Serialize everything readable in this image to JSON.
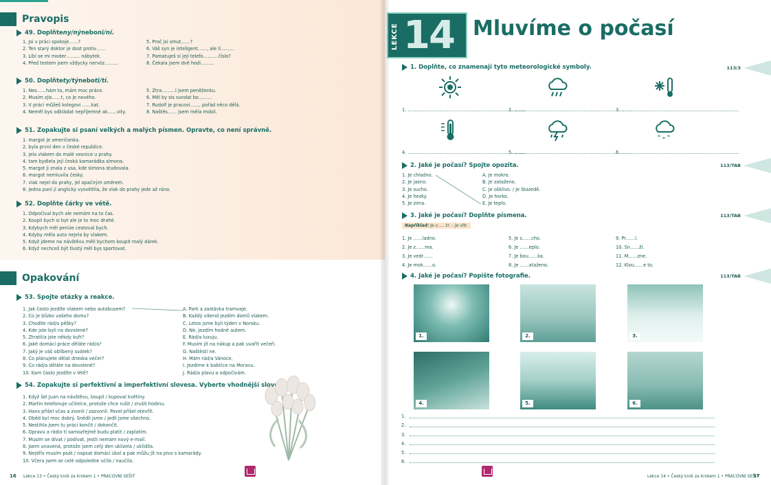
{
  "left": {
    "pravopis": {
      "title": "Pravopis",
      "t49": {
        "label_a": "49. Doplňte ",
        "label_b": "ny/ný",
        "label_c": " nebo ",
        "label_d": "ni/ní.",
        "col1": [
          "1. Jsi v práci spokoje……?",
          "2. Ten starý doktor je dost protiv……",
          "3. Líbí se mi moder……… nábytek.",
          "4. Před testem jsem vždycky nervóz………"
        ],
        "col2": [
          "5. Proč jsi smut……?",
          "6. Váš syn je inteligent……, ale lí………",
          "7. Pamatuješ si její telefo……… číslo?",
          "8. Čekala jsem dvě hodi………"
        ]
      },
      "t50": {
        "label_a": "50. Doplňte ",
        "label_b": "ty/tý",
        "label_c": " nebo ",
        "label_d": "ti/tí.",
        "col1": [
          "1. Nes……hám to, mám moc práce.",
          "2. Musím zjis……t, co je nového.",
          "3. V práci můžeš kolegovi ……kat.",
          "4. Neměl bys odkládat nepříjemné ak……vity."
        ],
        "col2": [
          "5. Ztra………l jsem peněženku.",
          "6. Měl by sis sundat bo………",
          "7. Rudolf je pracovi……, pořád něco dělá.",
          "8. Naštěs…… jsem měla mobil."
        ]
      },
      "t51": {
        "label": "51. Zopakujte si psaní velkých a malých písmen. Opravte, co není správně.",
        "items": [
          "1. margot je američanka.",
          "2. byla první den v české republice.",
          "3. jela vlakem do malé vesnice u prahy.",
          "4. tam bydlela její česká kamarádka simona.",
          "5. margot ji znala z usa, kde simona studovala.",
          "6. margot nemluvila česky.",
          "7. vlak nejel do prahy, jel opačným směrem.",
          "8. jedna paní jí anglicky vysvětlila, že vlak do prahy jede až ráno."
        ]
      },
      "t52": {
        "label": "52. Doplňte čárky ve větě.",
        "items": [
          "1. Odpočíval bych ale nemám na to čas.",
          "2. Koupil bych si byt ale je to moc drahé.",
          "3. Kdybych měl peníze cestoval bych.",
          "4. Kdyby měla auto nejela by vlakem.",
          "5. Když jdeme na návštěvu měli bychom koupit malý dárek.",
          "6. Když nechceš být tlustý měl bys sportovat."
        ]
      }
    },
    "opakovani": {
      "title": "Opakování",
      "t53": {
        "label": "53. Spojte otázky a reakce.",
        "questions": [
          "1. Jak často jezdíte vlakem nebo autobusem?",
          "2. Co je blízko vašeho domu?",
          "3. Chodíte rád/a pěšky?",
          "4. Kde jste byli na dovolené?",
          "5. Ztratil/a jste někdy kufr?",
          "6. Jaké domácí práce děláte rád/a?",
          "7. Jaký je váš oblíbený svátek?",
          "8. Co plánujete dělat dneska večer?",
          "9. Co rád/a děláte na dovolené?",
          "10. Kam často jezdíte v létě?"
        ],
        "answers": [
          "A. Park a zastávka tramvaje.",
          "B. Každý víkend jezdím domů vlakem.",
          "C. Letos jsme byli týden v Norsku.",
          "D. Ne, jezdím hodně autem.",
          "E. Rád/a luxuju.",
          "F. Musím jít na nákup a pak uvařit večeři.",
          "G. Naštěstí ne.",
          "H. Mám rád/a Vánoce.",
          "I. Jezdíme k babičce na Moravu.",
          "J. Rád/a plavu a odpočívám."
        ]
      },
      "t54": {
        "label": "54. Zopakujte si perfektivní a imperfektivní slovesa. Vyberte vhodnější sloveso.",
        "items": [
          "1. Když šel Juan na návštěvu, koupil / kupoval květiny.",
          "2. Martin telefonuje učitelce, protože chce rušit / zrušit hodinu.",
          "3. Hans přišel včas a zvonil / zazvonil. Pavel přišel otevřít.",
          "4. Oběd byl moc dobrý. Snědli jsme / jedli jsme všechno.",
          "5. Nestihla jsem tu práci končit / dokončit.",
          "6. Opravu a rádio ti samozřejmě budu platit / zaplatím.",
          "7. Musím se dívat / podívat, jestli nemám nový e-mail.",
          "8. Jsem unavená, protože jsem celý den uklízela / uklidila.",
          "9. Nejdřív musím psát / napsat domácí úkol a pak můžu jít na pivo s kamarády.",
          "10. Včera jsem se celé odpoledne učila / naučila."
        ]
      }
    },
    "footer": {
      "page": "16",
      "text": "Lekce 13 • Český krok za krokem 1 • PRACOVNÍ SEŠIT"
    }
  },
  "right": {
    "lekce_word": "LEKCE",
    "lekce_number": "14",
    "title": "Mluvíme o počasí",
    "t1": {
      "label": "1. Doplňte, co znamenají tyto meteorologické symboly.",
      "ref": "113/3",
      "lines_row1": [
        "1. ……………………………………………………………………",
        "2. ……………………………………………………………………",
        "3. ……………………………………………………………………"
      ],
      "lines_row2": [
        "4. ……………………………………………………………………",
        "5. ……………………………………………………………………",
        "6. ……………………………………………………………………"
      ],
      "icons": [
        "sun-icon",
        "rain-cloud-icon",
        "frost-thermometer-icon",
        "hot-thermometer-icon",
        "storm-cloud-icon",
        "snow-cloud-icon"
      ]
    },
    "t2": {
      "label": "2. Jaké je počasí? Spojte opozita.",
      "ref": "113/TAB",
      "col1": [
        "1. Je chladno.",
        "2. Je jasno.",
        "3. Je sucho.",
        "4. Je hezky.",
        "5. Je zima."
      ],
      "col2": [
        "A. Je mokro.",
        "B. Je zataženo.",
        "C. Je ošklivo. / Je škaredě.",
        "D. Je horko.",
        "E. Je teplo."
      ]
    },
    "t3": {
      "label": "3. Jaké je počasí? Doplňte písmena.",
      "ref": "113/TAB",
      "hint_label": "Například:",
      "hint_text": " Je v……tr. – Je vítr.",
      "col1": [
        "1. Je ……ladno.",
        "2. Je z……ma.",
        "3. Je vedr……",
        "4. Je mok……o."
      ],
      "col2": [
        "5. Je s……cho.",
        "6. Je ……eplo.",
        "7. Je bou……ka.",
        "8. Je ……ataženo."
      ],
      "col3": [
        "9. Pr……í.",
        "10. Sn……ží.",
        "11. M……zne.",
        "12. Klou……e to."
      ]
    },
    "t4": {
      "label": "4. Jaké je počasí? Popište fotografie.",
      "ref": "113/TAB",
      "photos": [
        "1.",
        "2.",
        "3.",
        "4.",
        "5.",
        "6."
      ],
      "lines": [
        "1.",
        "2.",
        "3.",
        "4.",
        "5.",
        "6."
      ]
    },
    "footer": {
      "text": "Lekce 14 • Český krok za krokem 1 • PRACOVNÍ SEŠIT",
      "page": "17"
    }
  },
  "colors": {
    "teal": "#1a6d64",
    "peach": "#fbe7d6",
    "wedge": "#cfe6e1",
    "logo": "#b0296e"
  }
}
